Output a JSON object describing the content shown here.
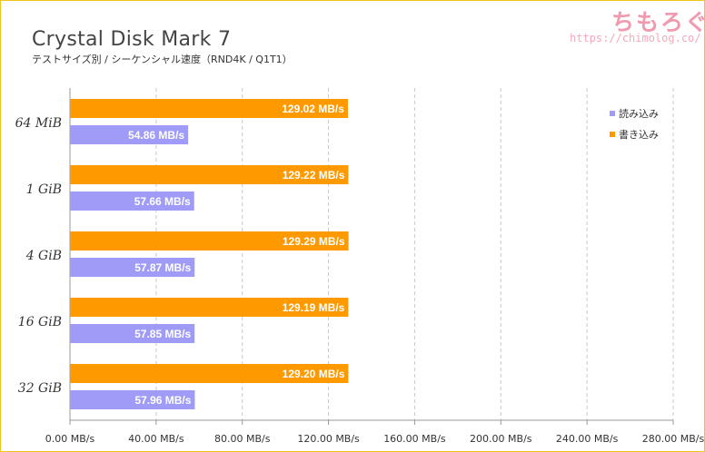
{
  "logo": {
    "text": "ちもろぐ",
    "url": "https://chimolog.co/"
  },
  "chart_data": {
    "type": "bar",
    "orientation": "horizontal",
    "title": "Crystal Disk Mark 7",
    "subtitle": "テストサイズ別 / シーケンシャル速度（RND4K / Q1T1）",
    "categories": [
      "64 MiB",
      "1 GiB",
      "4 GiB",
      "16 GiB",
      "32 GiB"
    ],
    "series": [
      {
        "name": "書き込み",
        "color": "#ff9900",
        "values": [
          129.02,
          129.22,
          129.29,
          129.19,
          129.2
        ],
        "labels": [
          "129.02 MB/s",
          "129.22 MB/s",
          "129.29 MB/s",
          "129.19 MB/s",
          "129.20 MB/s"
        ]
      },
      {
        "name": "読み込み",
        "color": "#9f9bf7",
        "values": [
          54.86,
          57.66,
          57.87,
          57.85,
          57.96
        ],
        "labels": [
          "54.86 MB/s",
          "57.66 MB/s",
          "57.87 MB/s",
          "57.85 MB/s",
          "57.96 MB/s"
        ]
      }
    ],
    "legend": {
      "position": "top-right",
      "order": [
        "読み込み",
        "書き込み"
      ]
    },
    "xlim": [
      0,
      280
    ],
    "xticks": [
      0,
      40,
      80,
      120,
      160,
      200,
      240,
      280
    ],
    "xtick_labels": [
      "0.00 MB/s",
      "40.00 MB/s",
      "80.00 MB/s",
      "120.00 MB/s",
      "160.00 MB/s",
      "200.00 MB/s",
      "240.00 MB/s",
      "280.00 MB/s"
    ],
    "grid": true
  }
}
